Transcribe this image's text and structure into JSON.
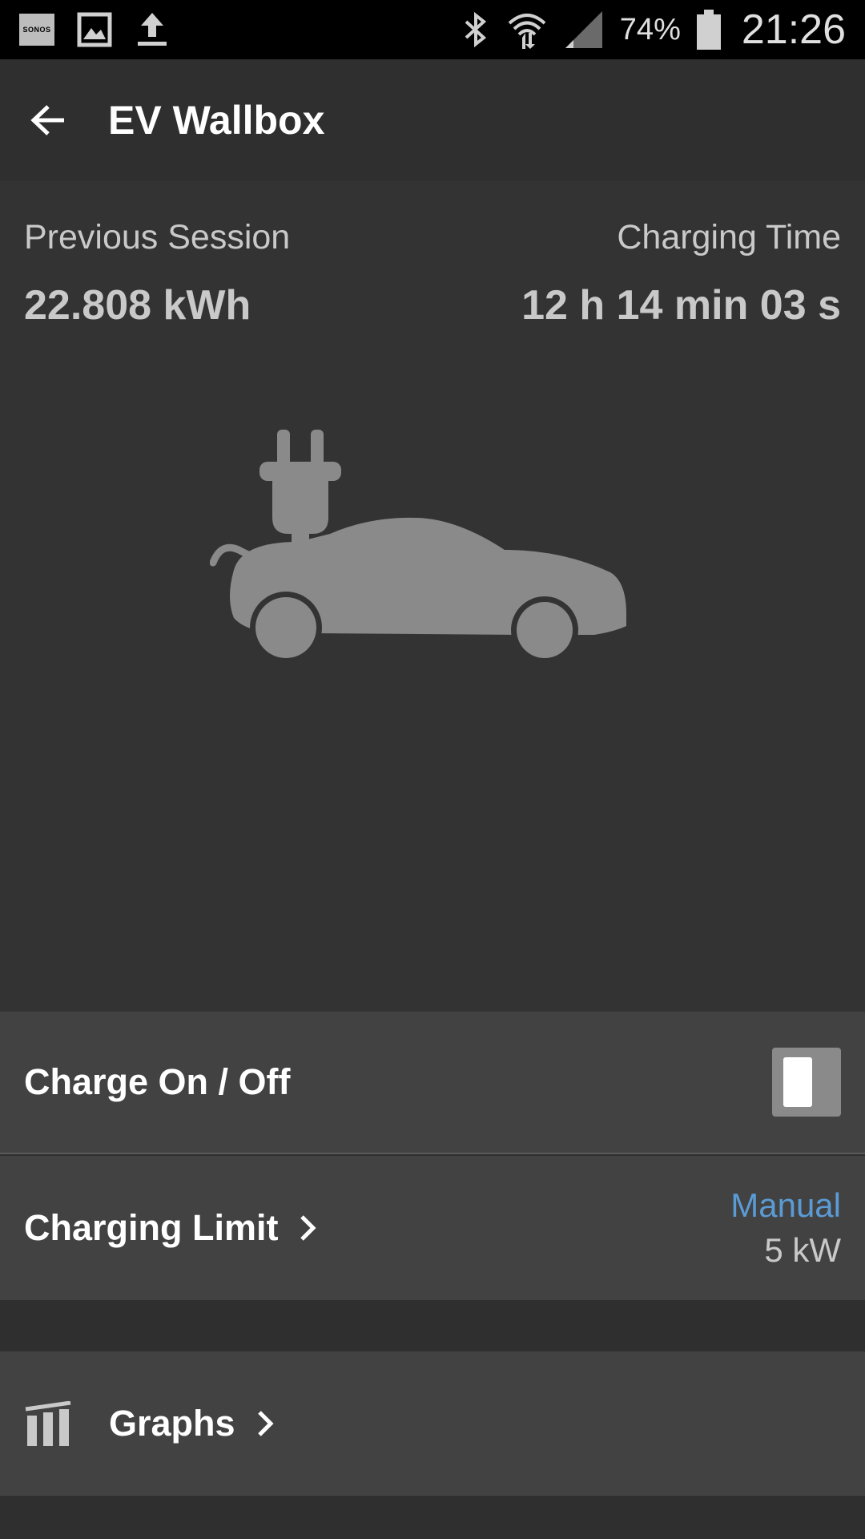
{
  "status_bar": {
    "battery_percent": "74%",
    "time": "21:26",
    "icons": [
      "sonos-icon",
      "image-icon",
      "upload-icon",
      "bluetooth-icon",
      "wifi-icon",
      "signal-icon",
      "battery-icon"
    ],
    "sonos_label": "SONOS"
  },
  "app_bar": {
    "title": "EV Wallbox"
  },
  "session": {
    "previous_label": "Previous Session",
    "previous_value": "22.808 kWh",
    "time_label": "Charging Time",
    "time_value": "12 h 14 min 03 s"
  },
  "charge_toggle": {
    "label": "Charge On / Off",
    "state": "off"
  },
  "charging_limit": {
    "label": "Charging Limit",
    "mode": "Manual",
    "power": "5 kW"
  },
  "graphs": {
    "label": "Graphs"
  },
  "colors": {
    "accent": "#5b9bd5",
    "background": "#2f2f2f",
    "panel": "#333333",
    "row": "#424242"
  }
}
